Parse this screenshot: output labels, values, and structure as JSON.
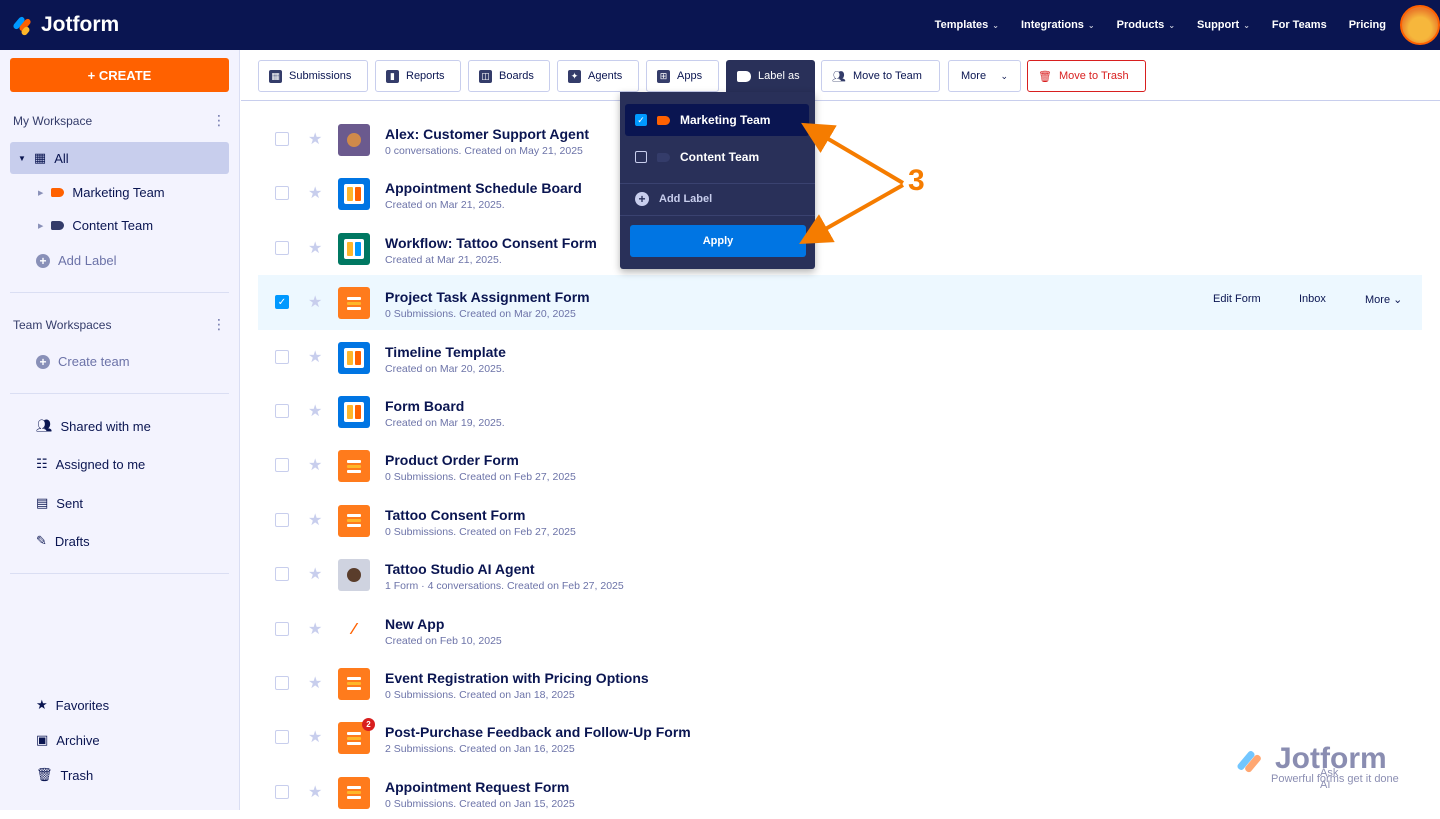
{
  "brand": "Jotform",
  "nav": [
    "Templates",
    "Integrations",
    "Products",
    "Support",
    "For Teams",
    "Pricing"
  ],
  "nav_chevrons": [
    true,
    true,
    true,
    true,
    false,
    false
  ],
  "sidebar": {
    "create": "+ CREATE",
    "my_workspace": "My Workspace",
    "all": "All",
    "labels": [
      {
        "name": "Marketing Team",
        "color": "#ff6100"
      },
      {
        "name": "Content Team",
        "color": "#343c6a"
      }
    ],
    "add_label": "Add Label",
    "team_workspaces": "Team Workspaces",
    "create_team": "Create team",
    "links": [
      "Shared with me",
      "Assigned to me",
      "Sent",
      "Drafts"
    ],
    "bottom": [
      "Favorites",
      "Archive",
      "Trash"
    ]
  },
  "toolbar": {
    "submissions": "Submissions",
    "reports": "Reports",
    "boards": "Boards",
    "agents": "Agents",
    "apps": "Apps",
    "label_as": "Label as",
    "move_to_team": "Move to Team",
    "more": "More",
    "move_to_trash": "Move to Trash"
  },
  "label_menu": {
    "items": [
      {
        "name": "Marketing Team",
        "checked": true
      },
      {
        "name": "Content Team",
        "checked": false
      }
    ],
    "add_label": "Add Label",
    "apply": "Apply"
  },
  "annotation": "3",
  "row_actions": {
    "edit": "Edit Form",
    "inbox": "Inbox",
    "more": "More"
  },
  "items": [
    {
      "title": "Alex: Customer Support Agent",
      "sub": "0 conversations. Created on May 21, 2025",
      "type": "agent"
    },
    {
      "title": "Appointment Schedule Board",
      "sub": "Created on Mar 21, 2025.",
      "type": "board"
    },
    {
      "title": "Workflow: Tattoo Consent Form",
      "sub": "Created at Mar 21, 2025.",
      "type": "workflow"
    },
    {
      "title": "Project Task Assignment Form",
      "sub": "0 Submissions. Created on Mar 20, 2025",
      "type": "form",
      "selected": true
    },
    {
      "title": "Timeline Template",
      "sub": "Created on Mar 20, 2025.",
      "type": "board"
    },
    {
      "title": "Form Board",
      "sub": "Created on Mar 19, 2025.",
      "type": "board"
    },
    {
      "title": "Product Order Form",
      "sub": "0 Submissions. Created on Feb 27, 2025",
      "type": "form"
    },
    {
      "title": "Tattoo Consent Form",
      "sub": "0 Submissions. Created on Feb 27, 2025",
      "type": "form"
    },
    {
      "title": "Tattoo Studio AI Agent",
      "sub": "1 Form · 4 conversations. Created on Feb 27, 2025",
      "type": "agent"
    },
    {
      "title": "New App",
      "sub": "Created on Feb 10, 2025",
      "type": "app"
    },
    {
      "title": "Event Registration with Pricing Options",
      "sub": "0 Submissions. Created on Jan 18, 2025",
      "type": "form"
    },
    {
      "title": "Post-Purchase Feedback and Follow-Up Form",
      "sub": "2 Submissions. Created on Jan 16, 2025",
      "type": "form",
      "badge": "2"
    },
    {
      "title": "Appointment Request Form",
      "sub": "0 Submissions. Created on Jan 15, 2025",
      "type": "form"
    }
  ],
  "watermark": {
    "brand": "Jotform",
    "tagline": "Powerful forms get it done",
    "ask": "Ask AI"
  }
}
